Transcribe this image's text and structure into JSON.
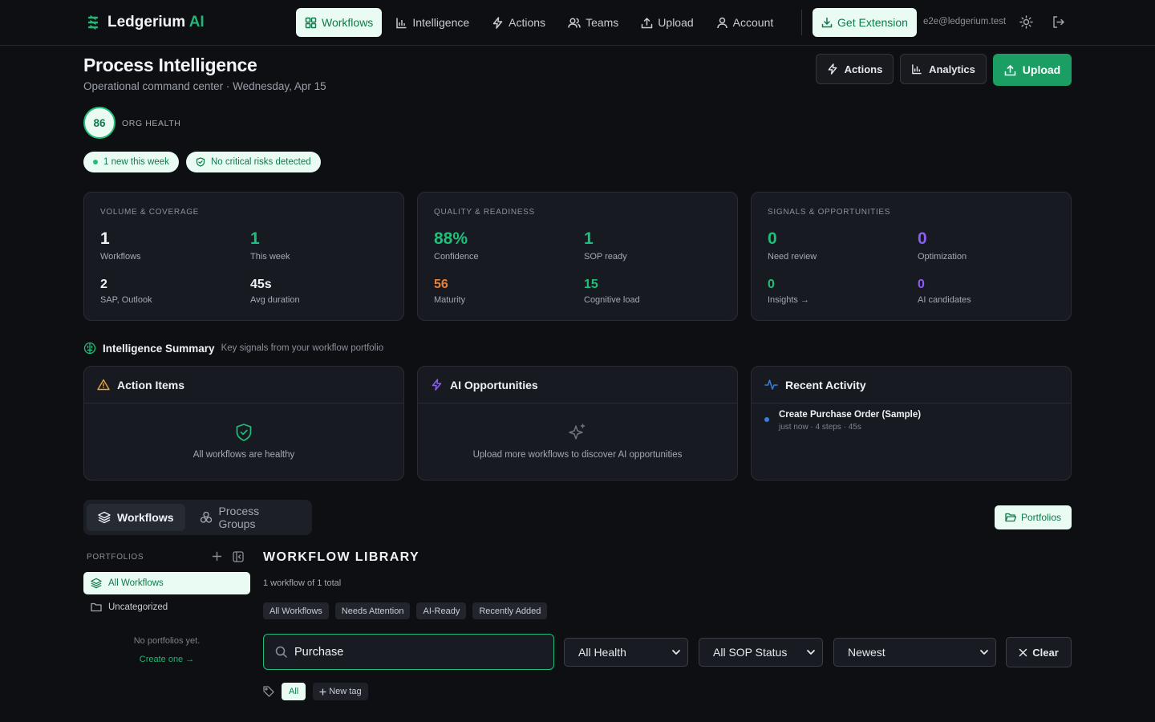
{
  "brand": {
    "name": "Ledgerium",
    "suffix": "AI"
  },
  "nav": {
    "items": [
      {
        "label": "Workflows",
        "icon": "grid-icon",
        "active": true
      },
      {
        "label": "Intelligence",
        "icon": "bar-chart-icon"
      },
      {
        "label": "Actions",
        "icon": "lightning-icon"
      },
      {
        "label": "Teams",
        "icon": "users-icon"
      },
      {
        "label": "Upload",
        "icon": "upload-icon"
      },
      {
        "label": "Account",
        "icon": "user-icon"
      }
    ],
    "extension_label": "Get Extension",
    "email": "e2e@ledgerium.test"
  },
  "header": {
    "title": "Process Intelligence",
    "subtitle": "Operational command center · Wednesday, Apr 15",
    "actions_label": "Actions",
    "analytics_label": "Analytics",
    "upload_label": "Upload"
  },
  "health": {
    "score": "86",
    "label": "ORG HEALTH"
  },
  "pills": {
    "new_week": "1 new this week",
    "no_risks": "No critical risks detected"
  },
  "cards": {
    "volume": {
      "title": "VOLUME & COVERAGE",
      "workflows": {
        "value": "1",
        "label": "Workflows"
      },
      "this_week": {
        "value": "1",
        "label": "This week"
      },
      "apps": {
        "value": "2",
        "label": "SAP, Outlook"
      },
      "avg": {
        "value": "45s",
        "label": "Avg duration"
      }
    },
    "quality": {
      "title": "QUALITY & READINESS",
      "confidence": {
        "value": "88%",
        "label": "Confidence"
      },
      "sop": {
        "value": "1",
        "label": "SOP ready"
      },
      "maturity": {
        "value": "56",
        "label": "Maturity"
      },
      "cognitive": {
        "value": "15",
        "label": "Cognitive load"
      }
    },
    "signals": {
      "title": "SIGNALS & OPPORTUNITIES",
      "review": {
        "value": "0",
        "label": "Need review"
      },
      "optimization": {
        "value": "0",
        "label": "Optimization"
      },
      "insights": {
        "value": "0",
        "label": "Insights →"
      },
      "ai": {
        "value": "0",
        "label": "AI candidates"
      }
    }
  },
  "colors": {
    "accent": "#1fbf7a",
    "orange": "#e8823a",
    "purple": "#8b5cf6",
    "warning": "#e8a33a"
  },
  "summary": {
    "title": "Intelligence Summary",
    "subtitle": "Key signals from your workflow portfolio",
    "action_items": {
      "title": "Action Items",
      "empty": "All workflows are healthy"
    },
    "ai_opps": {
      "title": "AI Opportunities",
      "empty": "Upload more workflows to discover AI opportunities"
    },
    "activity": {
      "title": "Recent Activity",
      "items": [
        {
          "title": "Create Purchase Order (Sample)",
          "meta": "just now · 4 steps · 45s"
        }
      ]
    }
  },
  "tabs": {
    "workflows": "Workflows",
    "groups": "Process Groups",
    "portfolios_btn": "Portfolios"
  },
  "sidebar": {
    "label": "PORTFOLIOS",
    "all": "All Workflows",
    "uncategorized": "Uncategorized",
    "empty": "No portfolios yet.",
    "create": "Create one →"
  },
  "library": {
    "title": "WORKFLOW LIBRARY",
    "count": "1 workflow of 1 total",
    "chips": [
      "All Workflows",
      "Needs Attention",
      "AI-Ready",
      "Recently Added"
    ],
    "search_value": "Purchase",
    "health_select": "All Health",
    "sop_select": "All SOP Status",
    "sort_select": "Newest",
    "clear_label": "Clear",
    "tag_all": "All",
    "tag_new": "New tag"
  }
}
